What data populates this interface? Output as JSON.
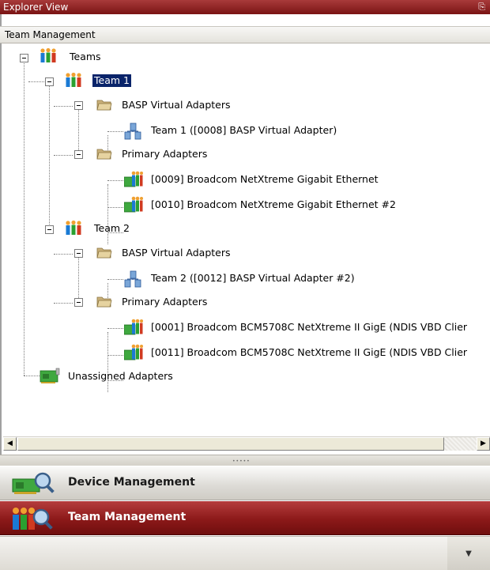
{
  "window": {
    "title": "Explorer View",
    "pin_glyph": "p"
  },
  "panel": {
    "title": "Team Management"
  },
  "tree": {
    "root": "Teams",
    "team1": "Team 1",
    "team1_basp_folder": "BASP Virtual Adapters",
    "team1_basp_adapter": "Team 1 ([0008] BASP Virtual Adapter)",
    "team1_primary_folder": "Primary Adapters",
    "team1_nic1": "[0009] Broadcom NetXtreme Gigabit Ethernet",
    "team1_nic2": "[0010] Broadcom NetXtreme Gigabit Ethernet #2",
    "team2": "Team 2",
    "team2_basp_folder": "BASP Virtual Adapters",
    "team2_basp_adapter": "Team 2 ([0012] BASP Virtual Adapter #2)",
    "team2_primary_folder": "Primary Adapters",
    "team2_nic1": "[0001] Broadcom BCM5708C NetXtreme II GigE (NDIS VBD Clier",
    "team2_nic2": "[0011] Broadcom BCM5708C NetXtreme II GigE (NDIS VBD Clier",
    "unassigned": "Unassigned Adapters"
  },
  "scrollbar": {
    "left_arrow": "◀",
    "right_arrow": "▶"
  },
  "splitter": {
    "grip": "•••••"
  },
  "nav": {
    "device_management": "Device Management",
    "team_management": "Team Management",
    "overflow_glyph": "▼"
  },
  "colors": {
    "accent": "#8c1919",
    "selection": "#0a246a"
  }
}
